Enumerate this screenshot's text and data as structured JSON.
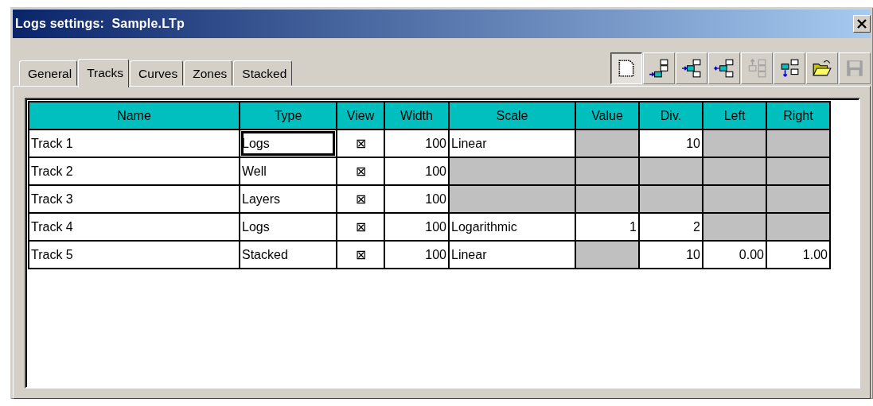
{
  "window": {
    "title": "Logs settings:  Sample.LTp"
  },
  "tabs": [
    {
      "label": "General",
      "selected": false
    },
    {
      "label": "Tracks",
      "selected": true
    },
    {
      "label": "Curves",
      "selected": false
    },
    {
      "label": "Zones",
      "selected": false
    },
    {
      "label": "Stacked",
      "selected": false
    }
  ],
  "toolbar": [
    {
      "kind": "page",
      "pressed": true,
      "disabled": false
    },
    {
      "kind": "append",
      "pressed": false,
      "disabled": false
    },
    {
      "kind": "insert",
      "pressed": false,
      "disabled": false
    },
    {
      "kind": "remove",
      "pressed": false,
      "disabled": false
    },
    {
      "kind": "moveup",
      "pressed": false,
      "disabled": true
    },
    {
      "kind": "movedown",
      "pressed": false,
      "disabled": false
    },
    {
      "kind": "open",
      "pressed": false,
      "disabled": false
    },
    {
      "kind": "save",
      "pressed": false,
      "disabled": true
    }
  ],
  "table": {
    "columns": [
      "Name",
      "Type",
      "View",
      "Width",
      "Scale",
      "Value",
      "Div.",
      "Left",
      "Right"
    ],
    "rows": [
      {
        "focused": true,
        "cells": [
          {
            "text": "Track 1",
            "disabled": false
          },
          {
            "text": "Logs",
            "disabled": false
          },
          {
            "text": "⊠",
            "disabled": false
          },
          {
            "text": "100",
            "disabled": false
          },
          {
            "text": "Linear",
            "disabled": false
          },
          {
            "text": "",
            "disabled": true
          },
          {
            "text": "10",
            "disabled": false
          },
          {
            "text": "",
            "disabled": true
          },
          {
            "text": "",
            "disabled": true
          }
        ]
      },
      {
        "focused": false,
        "cells": [
          {
            "text": "Track 2",
            "disabled": false
          },
          {
            "text": "Well",
            "disabled": false
          },
          {
            "text": "⊠",
            "disabled": false
          },
          {
            "text": "100",
            "disabled": false
          },
          {
            "text": "",
            "disabled": true
          },
          {
            "text": "",
            "disabled": true
          },
          {
            "text": "",
            "disabled": true
          },
          {
            "text": "",
            "disabled": true
          },
          {
            "text": "",
            "disabled": true
          }
        ]
      },
      {
        "focused": false,
        "cells": [
          {
            "text": "Track 3",
            "disabled": false
          },
          {
            "text": "Layers",
            "disabled": false
          },
          {
            "text": "⊠",
            "disabled": false
          },
          {
            "text": "100",
            "disabled": false
          },
          {
            "text": "",
            "disabled": true
          },
          {
            "text": "",
            "disabled": true
          },
          {
            "text": "",
            "disabled": true
          },
          {
            "text": "",
            "disabled": true
          },
          {
            "text": "",
            "disabled": true
          }
        ]
      },
      {
        "focused": false,
        "cells": [
          {
            "text": "Track 4",
            "disabled": false
          },
          {
            "text": "Logs",
            "disabled": false
          },
          {
            "text": "⊠",
            "disabled": false
          },
          {
            "text": "100",
            "disabled": false
          },
          {
            "text": "Logarithmic",
            "disabled": false
          },
          {
            "text": "1",
            "disabled": false
          },
          {
            "text": "2",
            "disabled": false
          },
          {
            "text": "",
            "disabled": true
          },
          {
            "text": "",
            "disabled": true
          }
        ]
      },
      {
        "focused": false,
        "cells": [
          {
            "text": "Track 5",
            "disabled": false
          },
          {
            "text": "Stacked",
            "disabled": false
          },
          {
            "text": "⊠",
            "disabled": false
          },
          {
            "text": "100",
            "disabled": false
          },
          {
            "text": "Linear",
            "disabled": false
          },
          {
            "text": "",
            "disabled": true
          },
          {
            "text": "10",
            "disabled": false
          },
          {
            "text": "0.00",
            "disabled": false
          },
          {
            "text": "1.00",
            "disabled": false
          }
        ]
      }
    ]
  }
}
